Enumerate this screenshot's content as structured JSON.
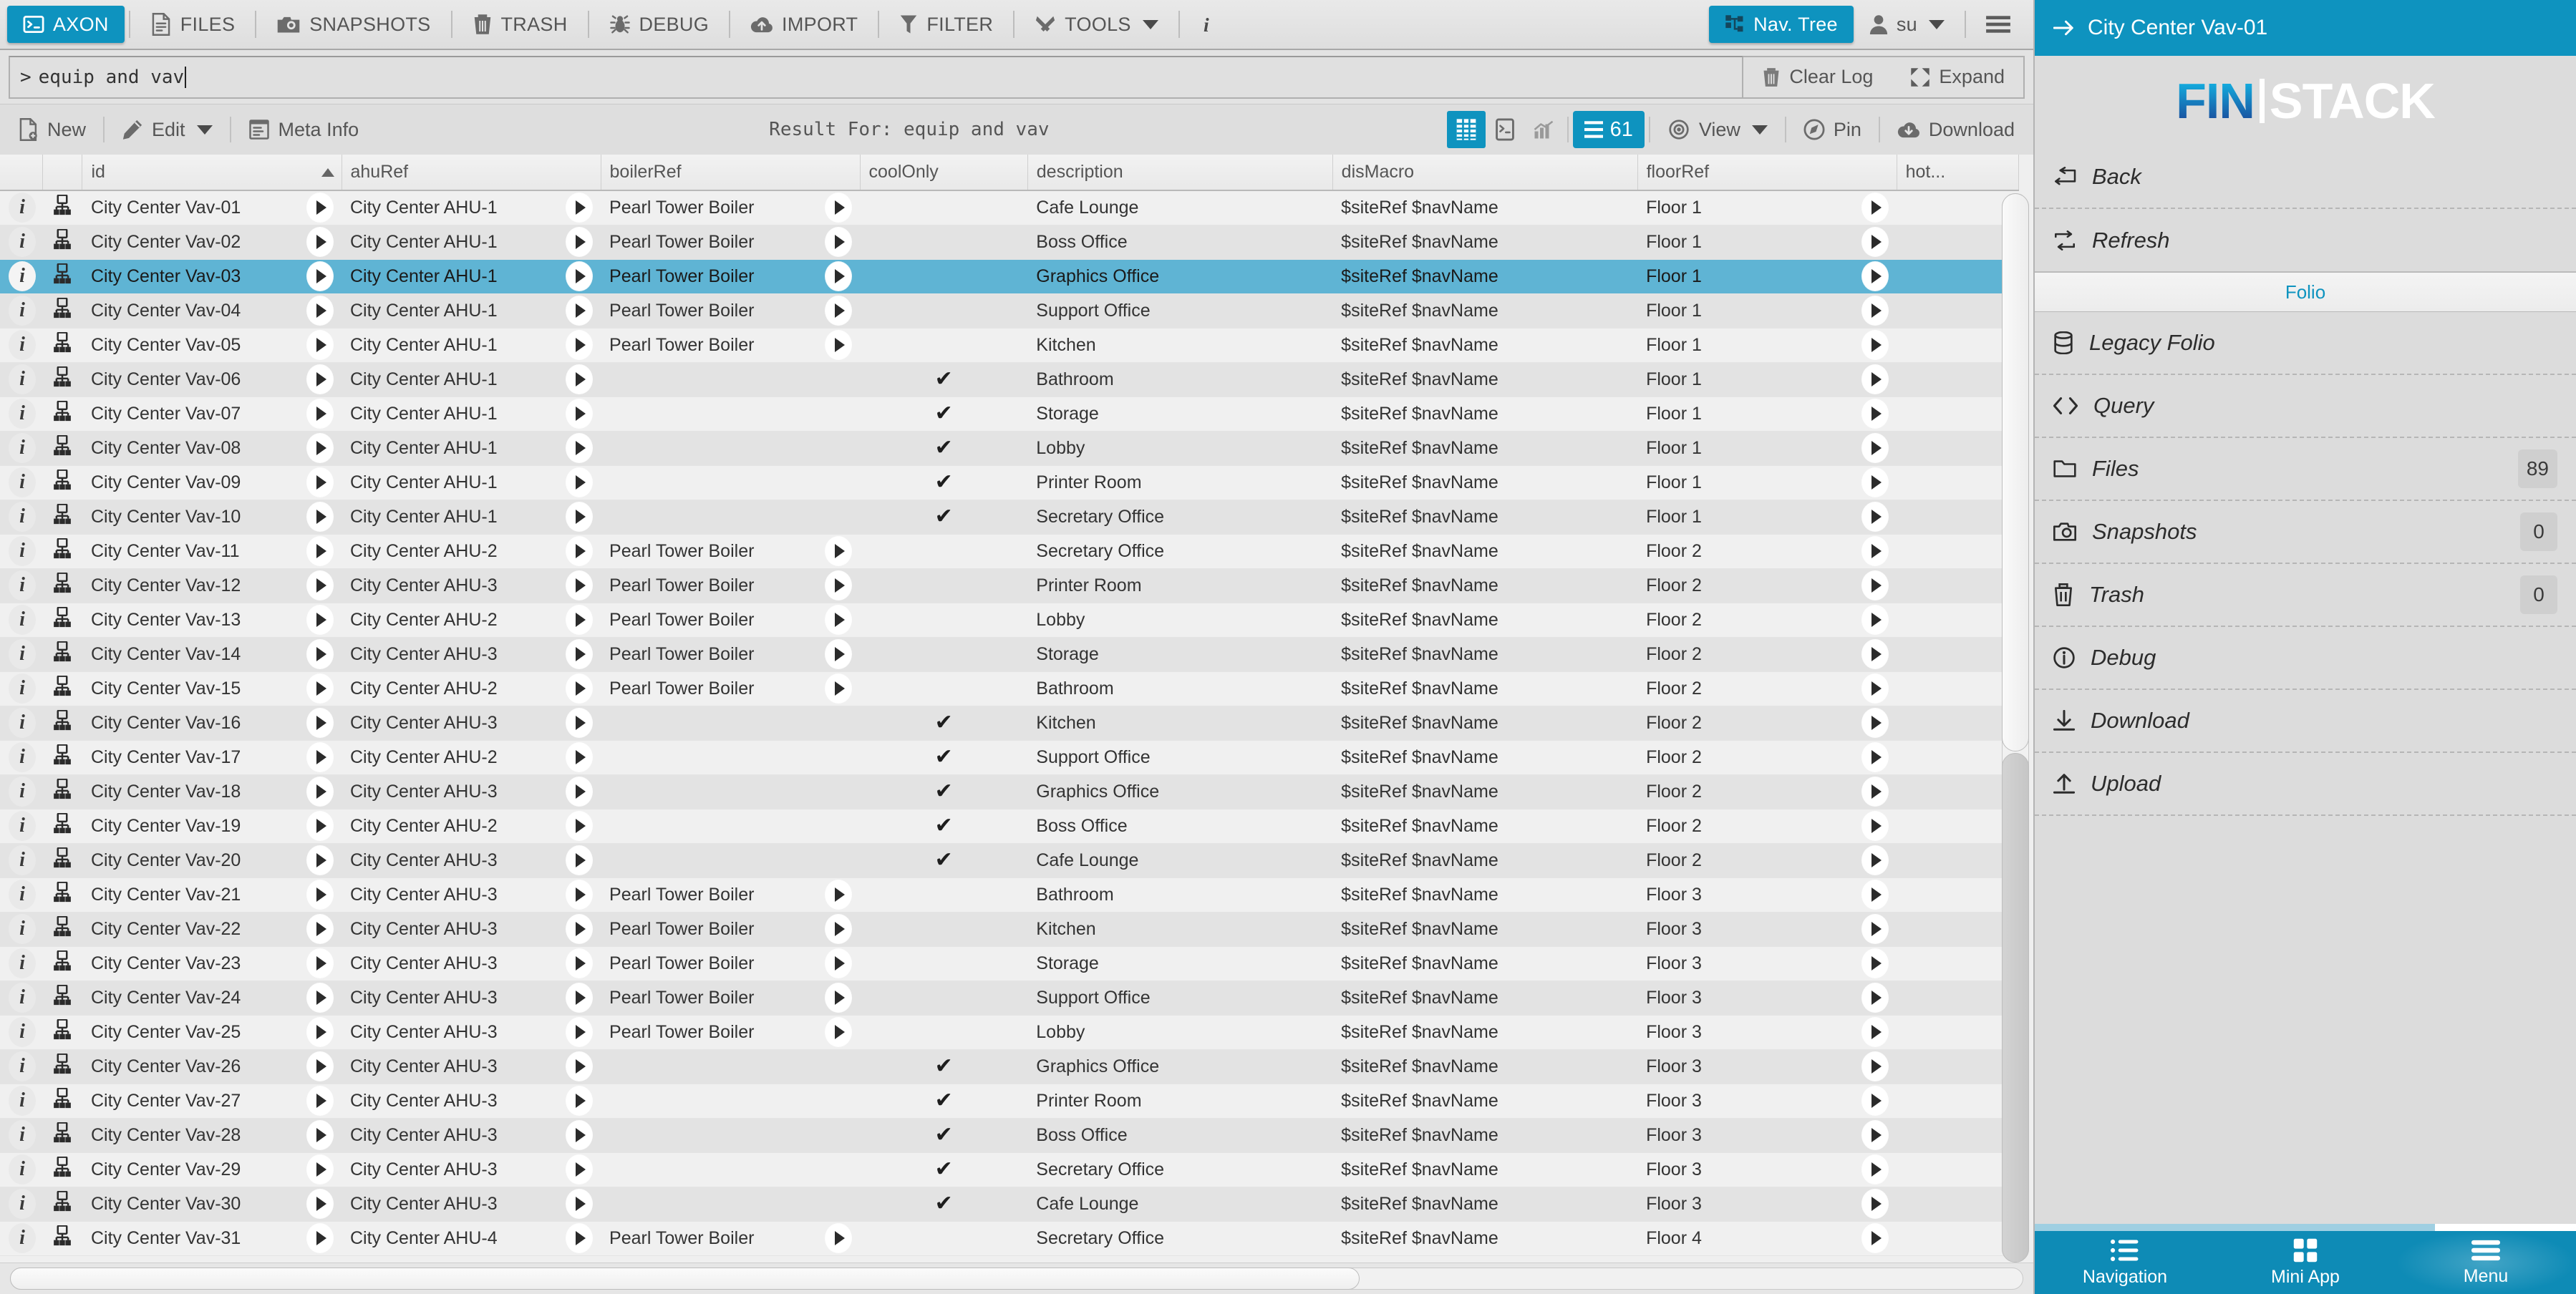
{
  "topbar": {
    "items": [
      {
        "label": "AXON",
        "icon": "console-icon",
        "active": true
      },
      {
        "label": "FILES",
        "icon": "file-icon",
        "active": false
      },
      {
        "label": "SNAPSHOTS",
        "icon": "camera-icon",
        "active": false
      },
      {
        "label": "TRASH",
        "icon": "trash-icon",
        "active": false
      },
      {
        "label": "DEBUG",
        "icon": "bug-icon",
        "active": false
      },
      {
        "label": "IMPORT",
        "icon": "import-cloud-icon",
        "active": false
      },
      {
        "label": "FILTER",
        "icon": "funnel-icon",
        "active": false
      },
      {
        "label": "TOOLS",
        "icon": "tools-icon",
        "active": false
      }
    ],
    "info_icon": "info-icon",
    "nav_tree_label": "Nav. Tree",
    "user_label": "su",
    "hamburger_icon": "hamburger-icon"
  },
  "query": {
    "prompt": ">",
    "value": "equip and vav",
    "placeholder": "",
    "clear_log_label": "Clear Log",
    "expand_label": "Expand"
  },
  "actionbar": {
    "new_label": "New",
    "edit_label": "Edit",
    "meta_info_label": "Meta Info",
    "result_label": "Result For: equip and vav",
    "count": "61",
    "view_label": "View",
    "pin_label": "Pin",
    "download_label": "Download"
  },
  "table": {
    "columns": [
      {
        "key": "id",
        "label": "id",
        "sorted": true
      },
      {
        "key": "ahuRef",
        "label": "ahuRef",
        "sorted": false
      },
      {
        "key": "boilerRef",
        "label": "boilerRef",
        "sorted": false
      },
      {
        "key": "coolOnly",
        "label": "coolOnly",
        "sorted": false
      },
      {
        "key": "description",
        "label": "description",
        "sorted": false
      },
      {
        "key": "disMacro",
        "label": "disMacro",
        "sorted": false
      },
      {
        "key": "floorRef",
        "label": "floorRef",
        "sorted": false
      },
      {
        "key": "hot",
        "label": "hot...",
        "sorted": false
      }
    ],
    "rows": [
      {
        "id": "City Center Vav-01",
        "ahuRef": "City Center AHU-1",
        "boilerRef": "Pearl Tower Boiler",
        "coolOnly": "",
        "description": "Cafe Lounge",
        "disMacro": "$siteRef $navName",
        "floorRef": "Floor 1",
        "selected": false
      },
      {
        "id": "City Center Vav-02",
        "ahuRef": "City Center AHU-1",
        "boilerRef": "Pearl Tower Boiler",
        "coolOnly": "",
        "description": "Boss Office",
        "disMacro": "$siteRef $navName",
        "floorRef": "Floor 1",
        "selected": false
      },
      {
        "id": "City Center Vav-03",
        "ahuRef": "City Center AHU-1",
        "boilerRef": "Pearl Tower Boiler",
        "coolOnly": "",
        "description": "Graphics Office",
        "disMacro": "$siteRef $navName",
        "floorRef": "Floor 1",
        "selected": true
      },
      {
        "id": "City Center Vav-04",
        "ahuRef": "City Center AHU-1",
        "boilerRef": "Pearl Tower Boiler",
        "coolOnly": "",
        "description": "Support Office",
        "disMacro": "$siteRef $navName",
        "floorRef": "Floor 1",
        "selected": false
      },
      {
        "id": "City Center Vav-05",
        "ahuRef": "City Center AHU-1",
        "boilerRef": "Pearl Tower Boiler",
        "coolOnly": "",
        "description": "Kitchen",
        "disMacro": "$siteRef $navName",
        "floorRef": "Floor 1",
        "selected": false
      },
      {
        "id": "City Center Vav-06",
        "ahuRef": "City Center AHU-1",
        "boilerRef": "",
        "coolOnly": "✔",
        "description": "Bathroom",
        "disMacro": "$siteRef $navName",
        "floorRef": "Floor 1",
        "selected": false
      },
      {
        "id": "City Center Vav-07",
        "ahuRef": "City Center AHU-1",
        "boilerRef": "",
        "coolOnly": "✔",
        "description": "Storage",
        "disMacro": "$siteRef $navName",
        "floorRef": "Floor 1",
        "selected": false
      },
      {
        "id": "City Center Vav-08",
        "ahuRef": "City Center AHU-1",
        "boilerRef": "",
        "coolOnly": "✔",
        "description": "Lobby",
        "disMacro": "$siteRef $navName",
        "floorRef": "Floor 1",
        "selected": false
      },
      {
        "id": "City Center Vav-09",
        "ahuRef": "City Center AHU-1",
        "boilerRef": "",
        "coolOnly": "✔",
        "description": "Printer Room",
        "disMacro": "$siteRef $navName",
        "floorRef": "Floor 1",
        "selected": false
      },
      {
        "id": "City Center Vav-10",
        "ahuRef": "City Center AHU-1",
        "boilerRef": "",
        "coolOnly": "✔",
        "description": "Secretary Office",
        "disMacro": "$siteRef $navName",
        "floorRef": "Floor 1",
        "selected": false
      },
      {
        "id": "City Center Vav-11",
        "ahuRef": "City Center AHU-2",
        "boilerRef": "Pearl Tower Boiler",
        "coolOnly": "",
        "description": "Secretary Office",
        "disMacro": "$siteRef $navName",
        "floorRef": "Floor 2",
        "selected": false
      },
      {
        "id": "City Center Vav-12",
        "ahuRef": "City Center AHU-3",
        "boilerRef": "Pearl Tower Boiler",
        "coolOnly": "",
        "description": "Printer Room",
        "disMacro": "$siteRef $navName",
        "floorRef": "Floor 2",
        "selected": false
      },
      {
        "id": "City Center Vav-13",
        "ahuRef": "City Center AHU-2",
        "boilerRef": "Pearl Tower Boiler",
        "coolOnly": "",
        "description": "Lobby",
        "disMacro": "$siteRef $navName",
        "floorRef": "Floor 2",
        "selected": false
      },
      {
        "id": "City Center Vav-14",
        "ahuRef": "City Center AHU-3",
        "boilerRef": "Pearl Tower Boiler",
        "coolOnly": "",
        "description": "Storage",
        "disMacro": "$siteRef $navName",
        "floorRef": "Floor 2",
        "selected": false
      },
      {
        "id": "City Center Vav-15",
        "ahuRef": "City Center AHU-2",
        "boilerRef": "Pearl Tower Boiler",
        "coolOnly": "",
        "description": "Bathroom",
        "disMacro": "$siteRef $navName",
        "floorRef": "Floor 2",
        "selected": false
      },
      {
        "id": "City Center Vav-16",
        "ahuRef": "City Center AHU-3",
        "boilerRef": "",
        "coolOnly": "✔",
        "description": "Kitchen",
        "disMacro": "$siteRef $navName",
        "floorRef": "Floor 2",
        "selected": false
      },
      {
        "id": "City Center Vav-17",
        "ahuRef": "City Center AHU-2",
        "boilerRef": "",
        "coolOnly": "✔",
        "description": "Support Office",
        "disMacro": "$siteRef $navName",
        "floorRef": "Floor 2",
        "selected": false
      },
      {
        "id": "City Center Vav-18",
        "ahuRef": "City Center AHU-3",
        "boilerRef": "",
        "coolOnly": "✔",
        "description": "Graphics Office",
        "disMacro": "$siteRef $navName",
        "floorRef": "Floor 2",
        "selected": false
      },
      {
        "id": "City Center Vav-19",
        "ahuRef": "City Center AHU-2",
        "boilerRef": "",
        "coolOnly": "✔",
        "description": "Boss Office",
        "disMacro": "$siteRef $navName",
        "floorRef": "Floor 2",
        "selected": false
      },
      {
        "id": "City Center Vav-20",
        "ahuRef": "City Center AHU-3",
        "boilerRef": "",
        "coolOnly": "✔",
        "description": "Cafe Lounge",
        "disMacro": "$siteRef $navName",
        "floorRef": "Floor 2",
        "selected": false
      },
      {
        "id": "City Center Vav-21",
        "ahuRef": "City Center AHU-3",
        "boilerRef": "Pearl Tower Boiler",
        "coolOnly": "",
        "description": "Bathroom",
        "disMacro": "$siteRef $navName",
        "floorRef": "Floor 3",
        "selected": false
      },
      {
        "id": "City Center Vav-22",
        "ahuRef": "City Center AHU-3",
        "boilerRef": "Pearl Tower Boiler",
        "coolOnly": "",
        "description": "Kitchen",
        "disMacro": "$siteRef $navName",
        "floorRef": "Floor 3",
        "selected": false
      },
      {
        "id": "City Center Vav-23",
        "ahuRef": "City Center AHU-3",
        "boilerRef": "Pearl Tower Boiler",
        "coolOnly": "",
        "description": "Storage",
        "disMacro": "$siteRef $navName",
        "floorRef": "Floor 3",
        "selected": false
      },
      {
        "id": "City Center Vav-24",
        "ahuRef": "City Center AHU-3",
        "boilerRef": "Pearl Tower Boiler",
        "coolOnly": "",
        "description": "Support Office",
        "disMacro": "$siteRef $navName",
        "floorRef": "Floor 3",
        "selected": false
      },
      {
        "id": "City Center Vav-25",
        "ahuRef": "City Center AHU-3",
        "boilerRef": "Pearl Tower Boiler",
        "coolOnly": "",
        "description": "Lobby",
        "disMacro": "$siteRef $navName",
        "floorRef": "Floor 3",
        "selected": false
      },
      {
        "id": "City Center Vav-26",
        "ahuRef": "City Center AHU-3",
        "boilerRef": "",
        "coolOnly": "✔",
        "description": "Graphics Office",
        "disMacro": "$siteRef $navName",
        "floorRef": "Floor 3",
        "selected": false
      },
      {
        "id": "City Center Vav-27",
        "ahuRef": "City Center AHU-3",
        "boilerRef": "",
        "coolOnly": "✔",
        "description": "Printer Room",
        "disMacro": "$siteRef $navName",
        "floorRef": "Floor 3",
        "selected": false
      },
      {
        "id": "City Center Vav-28",
        "ahuRef": "City Center AHU-3",
        "boilerRef": "",
        "coolOnly": "✔",
        "description": "Boss Office",
        "disMacro": "$siteRef $navName",
        "floorRef": "Floor 3",
        "selected": false
      },
      {
        "id": "City Center Vav-29",
        "ahuRef": "City Center AHU-3",
        "boilerRef": "",
        "coolOnly": "✔",
        "description": "Secretary Office",
        "disMacro": "$siteRef $navName",
        "floorRef": "Floor 3",
        "selected": false
      },
      {
        "id": "City Center Vav-30",
        "ahuRef": "City Center AHU-3",
        "boilerRef": "",
        "coolOnly": "✔",
        "description": "Cafe Lounge",
        "disMacro": "$siteRef $navName",
        "floorRef": "Floor 3",
        "selected": false
      },
      {
        "id": "City Center Vav-31",
        "ahuRef": "City Center AHU-4",
        "boilerRef": "Pearl Tower Boiler",
        "coolOnly": "",
        "description": "Secretary Office",
        "disMacro": "$siteRef $navName",
        "floorRef": "Floor 4",
        "selected": false
      }
    ]
  },
  "sidebar": {
    "header_title": "City Center Vav-01",
    "header_icon": "arrow-right-icon",
    "logo_fin": "FIN",
    "logo_stack": "STACK",
    "section_folio": "Folio",
    "items_top": [
      {
        "label": "Back",
        "icon": "back-icon",
        "badge": ""
      },
      {
        "label": "Refresh",
        "icon": "refresh-icon",
        "badge": ""
      }
    ],
    "items_bottom": [
      {
        "label": "Legacy Folio",
        "icon": "database-icon",
        "badge": ""
      },
      {
        "label": "Query",
        "icon": "code-icon",
        "badge": ""
      },
      {
        "label": "Files",
        "icon": "folder-icon",
        "badge": "89"
      },
      {
        "label": "Snapshots",
        "icon": "camera-icon",
        "badge": "0"
      },
      {
        "label": "Trash",
        "icon": "trash-icon",
        "badge": "0"
      },
      {
        "label": "Debug",
        "icon": "info-circle-icon",
        "badge": ""
      },
      {
        "label": "Download",
        "icon": "download-icon",
        "badge": ""
      },
      {
        "label": "Upload",
        "icon": "upload-icon",
        "badge": ""
      }
    ],
    "bottom_nav": [
      {
        "label": "Navigation",
        "icon": "list-icon"
      },
      {
        "label": "Mini App",
        "icon": "grid-icon"
      },
      {
        "label": "Menu",
        "icon": "hamburger-icon"
      }
    ]
  },
  "colors": {
    "accent": "#0e93bf",
    "selection": "#5fb4d4",
    "toolbar_bg": "#e3e3e3"
  }
}
